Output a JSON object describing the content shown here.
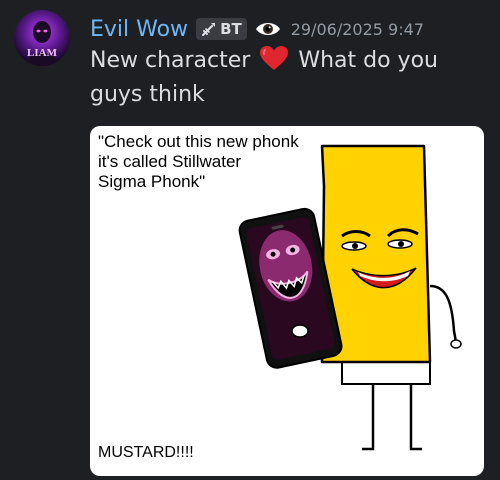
{
  "message": {
    "author": {
      "username": "Evil Wow",
      "avatar_text": "LIAM",
      "tag_icon": "sword-icon",
      "tag_text": "BT",
      "badge_icon": "eye-icon"
    },
    "timestamp": "29/06/2025 9:47",
    "content": {
      "text_before": "New character",
      "emoji": "heart-icon",
      "text_after": "What do you guys think"
    },
    "attachment": {
      "caption": "\"Check out this new phonk\nit's called Stillwater\nSigma Phonk\"",
      "bottom_text": "MUSTARD!!!!"
    }
  },
  "colors": {
    "background": "#1e1f22",
    "username": "#6fb6f5",
    "message_text": "#dbdee1",
    "timestamp": "#949ba4",
    "heart": "#e0262e",
    "mustard": "#ffd200"
  }
}
